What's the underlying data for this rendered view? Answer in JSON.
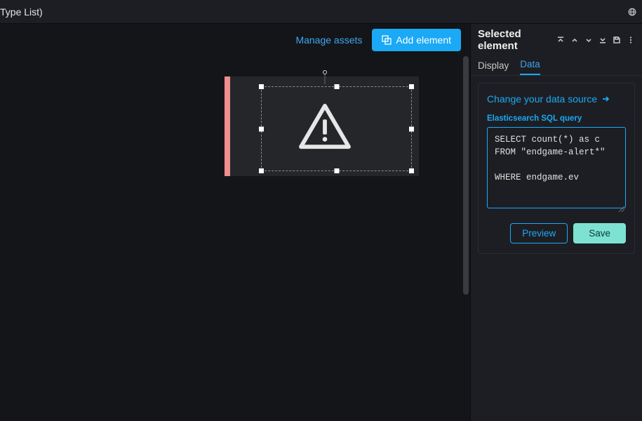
{
  "topbar": {
    "title": "Type List)",
    "right_icon": "globe-icon"
  },
  "toolbar": {
    "manage_assets_label": "Manage assets",
    "add_element_label": "Add element"
  },
  "side": {
    "title": "Selected element",
    "tabs": {
      "display": "Display",
      "data": "Data"
    },
    "change_ds_label": "Change your data source",
    "query_label": "Elasticsearch SQL query",
    "query_value": "SELECT count(*) as c FROM \"endgame-alert*\"\n\nWHERE endgame.ev",
    "preview_label": "Preview",
    "save_label": "Save"
  },
  "canvas": {
    "element_icon": "warning-icon",
    "accent_color": "#f08d8d"
  }
}
